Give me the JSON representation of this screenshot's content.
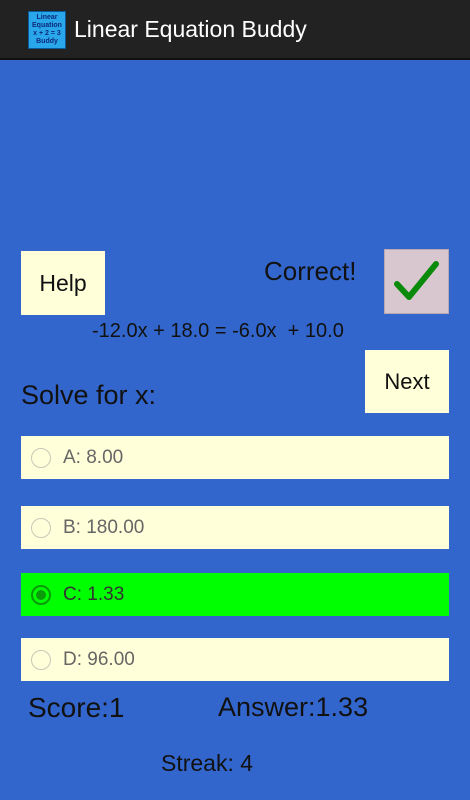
{
  "app": {
    "title": "Linear Equation Buddy",
    "icon_text_line1": "Linear",
    "icon_text_line2": "Equation",
    "icon_text_line3": "x + 2 = 3",
    "icon_text_line4": "Buddy"
  },
  "buttons": {
    "help": "Help",
    "next": "Next"
  },
  "feedback": {
    "text": "Correct!",
    "icon": "checkmark-icon",
    "icon_color": "#0a8a0a"
  },
  "equation": "-12.0x + 18.0 = -6.0x  + 10.0",
  "prompt": "Solve for x:",
  "choices": [
    {
      "label": "A: 8.00",
      "selected": false
    },
    {
      "label": "B: 180.00",
      "selected": false
    },
    {
      "label": "C: 1.33",
      "selected": true
    },
    {
      "label": "D: 96.00",
      "selected": false
    }
  ],
  "stats": {
    "score": "Score:1",
    "answer": "Answer:1.33",
    "streak": "Streak: 4"
  },
  "colors": {
    "background": "#3366cc",
    "button": "#ffffd9",
    "selected_choice": "#00ff00",
    "titlebar": "#222222"
  }
}
